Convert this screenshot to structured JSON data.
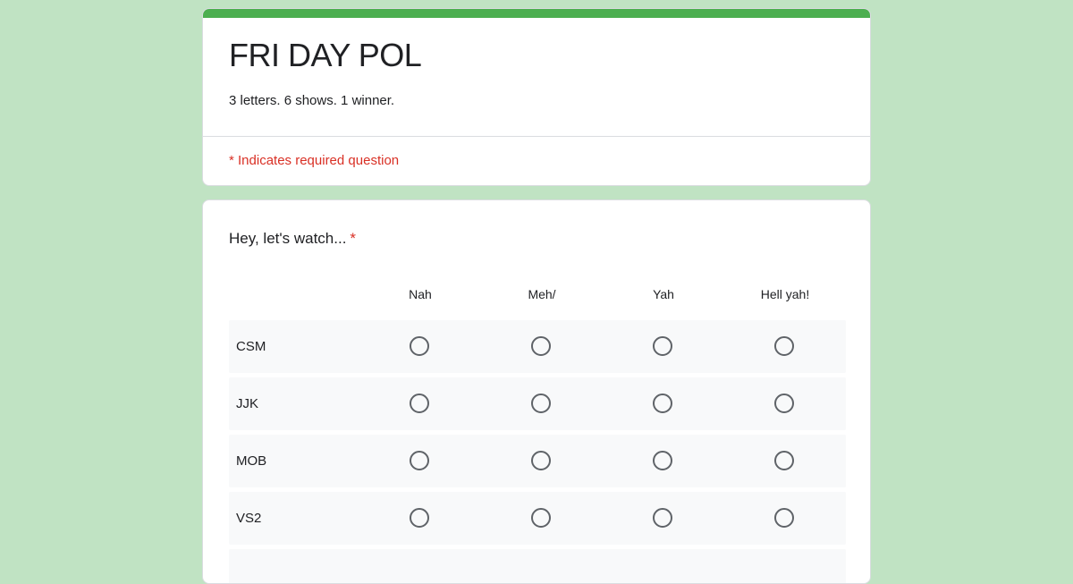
{
  "colors": {
    "background": "#c0e3c3",
    "accent": "#4caf50",
    "required": "#d93025"
  },
  "form": {
    "title": "FRI DAY POL",
    "description": "3 letters. 6 shows. 1 winner.",
    "required_note": "* Indicates required question"
  },
  "question": {
    "title": "Hey, let's watch...",
    "required_marker": "*",
    "columns": [
      "Nah",
      "Meh/",
      "Yah",
      "Hell yah!"
    ],
    "rows": [
      "CSM",
      "JJK",
      "MOB",
      "VS2"
    ],
    "radio_icon": "radio-unchecked-icon"
  }
}
